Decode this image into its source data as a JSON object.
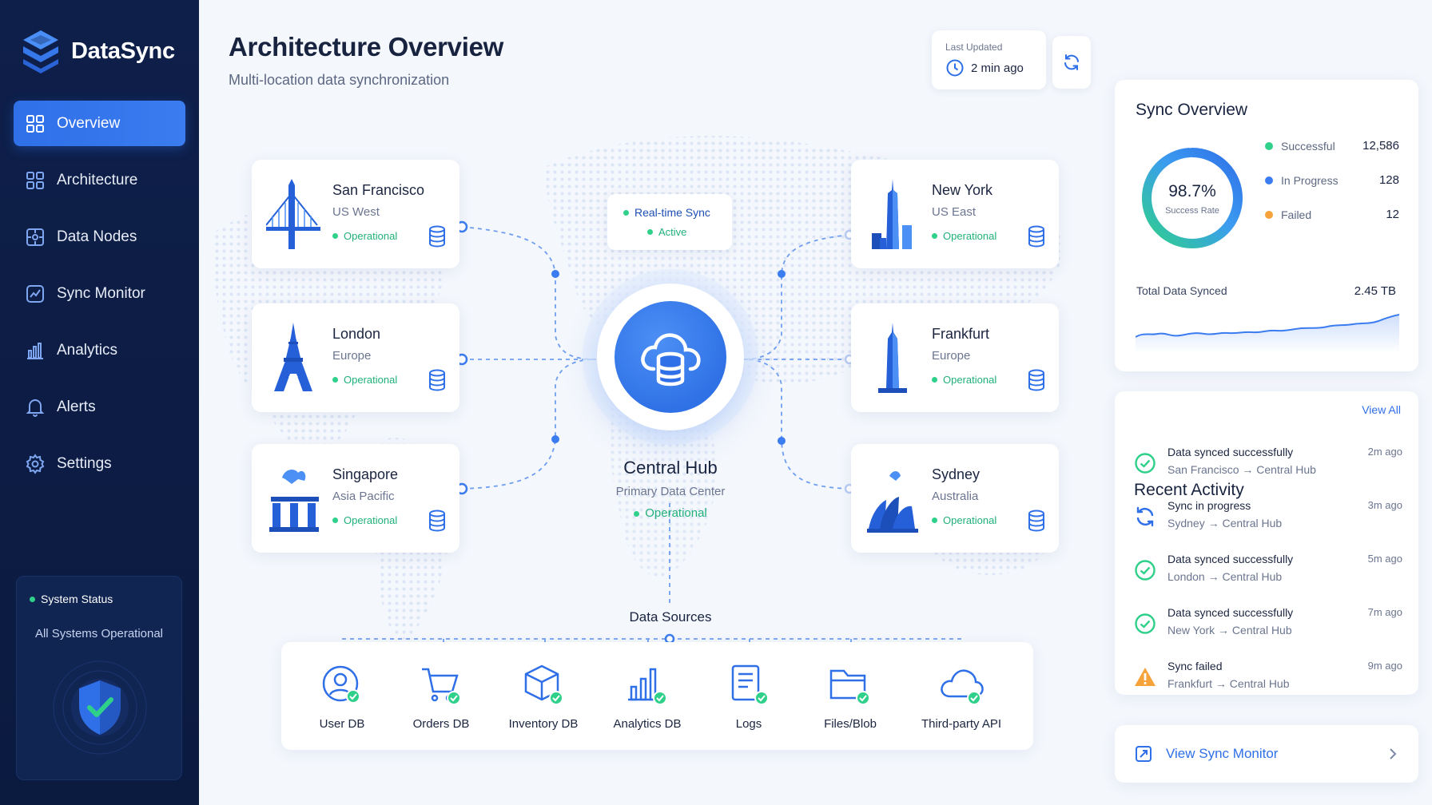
{
  "brand": {
    "name": "DataSync"
  },
  "sidebar": {
    "items": [
      {
        "label": "Overview",
        "icon": "grid-icon",
        "active": true
      },
      {
        "label": "Architecture",
        "icon": "architecture-icon"
      },
      {
        "label": "Data Nodes",
        "icon": "data-nodes-icon"
      },
      {
        "label": "Sync Monitor",
        "icon": "monitor-icon"
      },
      {
        "label": "Analytics",
        "icon": "bar-chart-icon"
      },
      {
        "label": "Alerts",
        "icon": "bell-icon"
      },
      {
        "label": "Settings",
        "icon": "gear-icon"
      }
    ],
    "status": {
      "title": "System Status",
      "text": "All Systems Operational"
    }
  },
  "header": {
    "title": "Architecture Overview",
    "subtitle": "Multi-location data synchronization",
    "last_updated_label": "Last Updated",
    "last_updated_value": "2 min ago"
  },
  "nodes": {
    "sf": {
      "name": "San Francisco",
      "region": "US West",
      "status": "Operational"
    },
    "london": {
      "name": "London",
      "region": "Europe",
      "status": "Operational"
    },
    "singapore": {
      "name": "Singapore",
      "region": "Asia Pacific",
      "status": "Operational"
    },
    "ny": {
      "name": "New York",
      "region": "US East",
      "status": "Operational"
    },
    "frankfurt": {
      "name": "Frankfurt",
      "region": "Europe",
      "status": "Operational"
    },
    "sydney": {
      "name": "Sydney",
      "region": "Australia",
      "status": "Operational"
    }
  },
  "sync_badge": {
    "label": "Real-time Sync",
    "status": "Active"
  },
  "hub": {
    "title": "Central Hub",
    "subtitle": "Primary Data Center",
    "status": "Operational"
  },
  "data_sources": {
    "title": "Data Sources",
    "items": [
      "User DB",
      "Orders DB",
      "Inventory DB",
      "Analytics DB",
      "Logs",
      "Files/Blob",
      "Third-party API"
    ]
  },
  "sync_overview": {
    "title": "Sync Overview",
    "success_rate": "98.7%",
    "success_rate_fraction": 0.987,
    "success_rate_label": "Success Rate",
    "legend": [
      {
        "label": "Successful",
        "value": "12,586",
        "color": "#2fd08a"
      },
      {
        "label": "In Progress",
        "value": "128",
        "color": "#3b7cf0"
      },
      {
        "label": "Failed",
        "value": "12",
        "color": "#f5a33a"
      }
    ],
    "total_label": "Total Data Synced",
    "total_value": "2.45 TB"
  },
  "recent_activity": {
    "title": "Recent Activity",
    "view_all": "View All",
    "items": [
      {
        "title": "Data synced successfully",
        "sub": "San Francisco → Central Hub",
        "time": "2m ago",
        "icon": "check-circle-icon"
      },
      {
        "title": "Sync in progress",
        "sub": "Sydney → Central Hub",
        "time": "3m ago",
        "icon": "sync-icon"
      },
      {
        "title": "Data synced successfully",
        "sub": "London → Central Hub",
        "time": "5m ago",
        "icon": "check-circle-icon"
      },
      {
        "title": "Data synced successfully",
        "sub": "New York → Central Hub",
        "time": "7m ago",
        "icon": "check-circle-icon"
      },
      {
        "title": "Sync failed",
        "sub": "Frankfurt → Central Hub",
        "time": "9m ago",
        "icon": "warning-icon"
      }
    ]
  },
  "view_sync_monitor": "View Sync Monitor",
  "colors": {
    "accent": "#2f6fe8",
    "sidebar": "#0e1f4a",
    "success": "#2fd08a",
    "warning": "#f5a33a"
  }
}
